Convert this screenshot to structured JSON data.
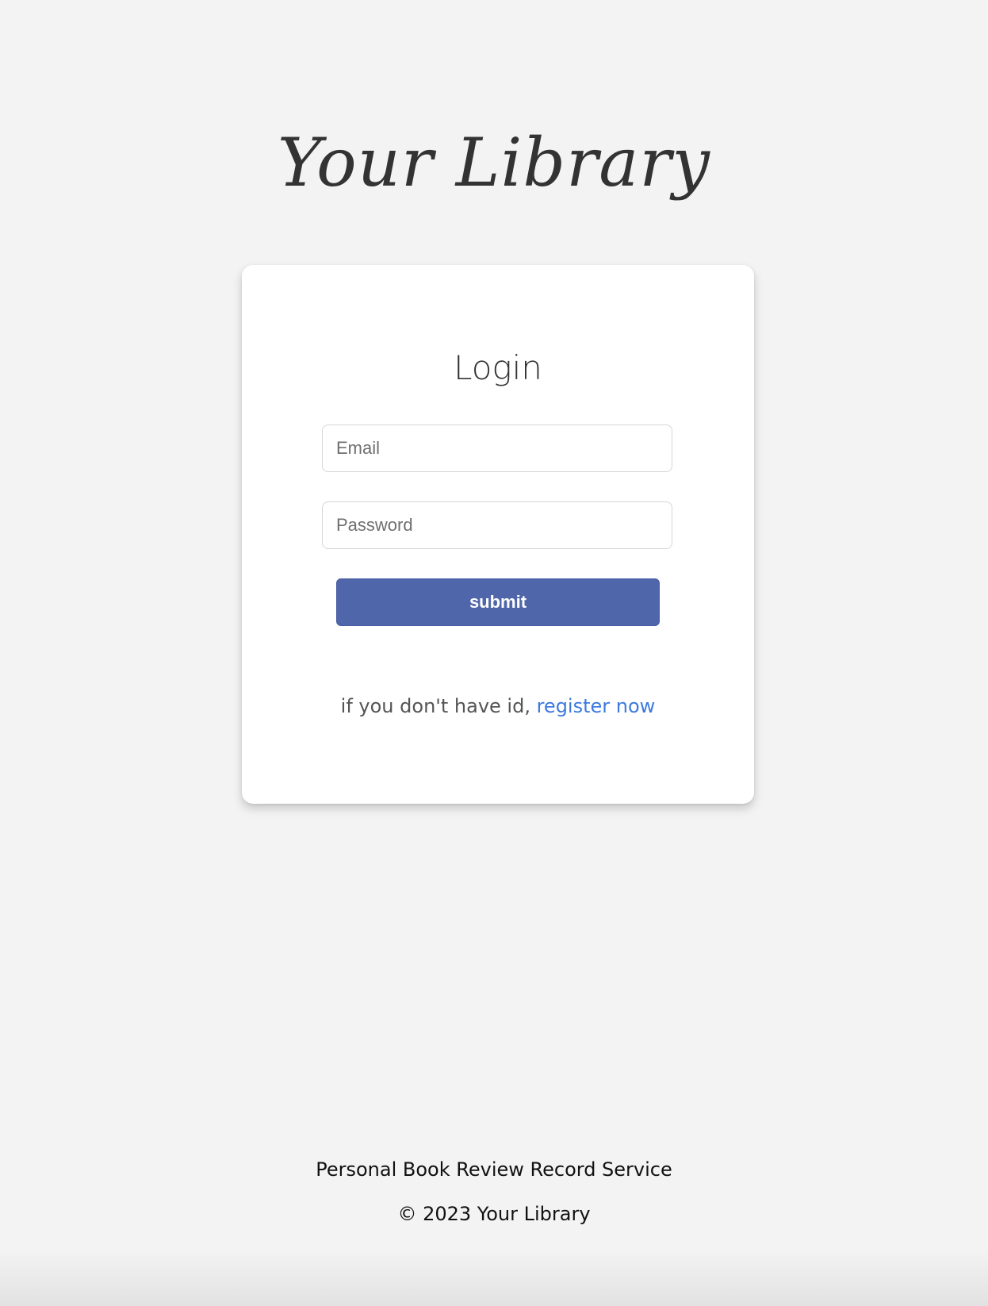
{
  "header": {
    "logo_text": "Your Library"
  },
  "login_card": {
    "title": "Login",
    "email_placeholder": "Email",
    "password_placeholder": "Password",
    "submit_label": "submit",
    "register_prompt": "if you don't have id, ",
    "register_link": "register now"
  },
  "footer": {
    "tagline": "Personal Book Review Record Service",
    "copyright": "© 2023 Your Library"
  },
  "colors": {
    "background": "#f3f3f3",
    "card": "#ffffff",
    "primary_button": "#5066aa",
    "link": "#3b7ae0",
    "text_dark": "#333333"
  }
}
